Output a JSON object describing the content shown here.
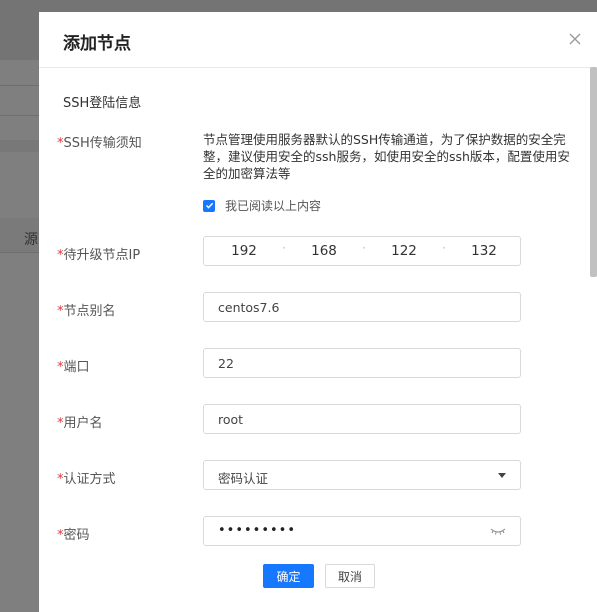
{
  "background": {
    "column_header_partial": "源"
  },
  "dialog": {
    "title": "添加节点",
    "section_title": "SSH登陆信息",
    "required_mark": "*",
    "fields": {
      "ssh_notice": {
        "label": "SSH传输须知",
        "text": "节点管理使用服务器默认的SSH传输通道，为了保护数据的安全完整，建议使用安全的ssh服务，如使用安全的ssh版本，配置使用安全的加密算法等",
        "agree_label": "我已阅读以上内容",
        "agreed": true
      },
      "node_ip": {
        "label": "待升级节点IP",
        "octets": [
          "192",
          "168",
          "122",
          "132"
        ],
        "separator": "·"
      },
      "alias": {
        "label": "节点别名",
        "value": "centos7.6"
      },
      "port": {
        "label": "端口",
        "value": "22"
      },
      "username": {
        "label": "用户名",
        "value": "root"
      },
      "auth_method": {
        "label": "认证方式",
        "value": "密码认证"
      },
      "password": {
        "label": "密码",
        "masked_value": "•••••••••"
      }
    },
    "buttons": {
      "confirm": "确定",
      "cancel": "取消"
    }
  },
  "colors": {
    "primary": "#1677ff",
    "required": "#e5333a"
  }
}
